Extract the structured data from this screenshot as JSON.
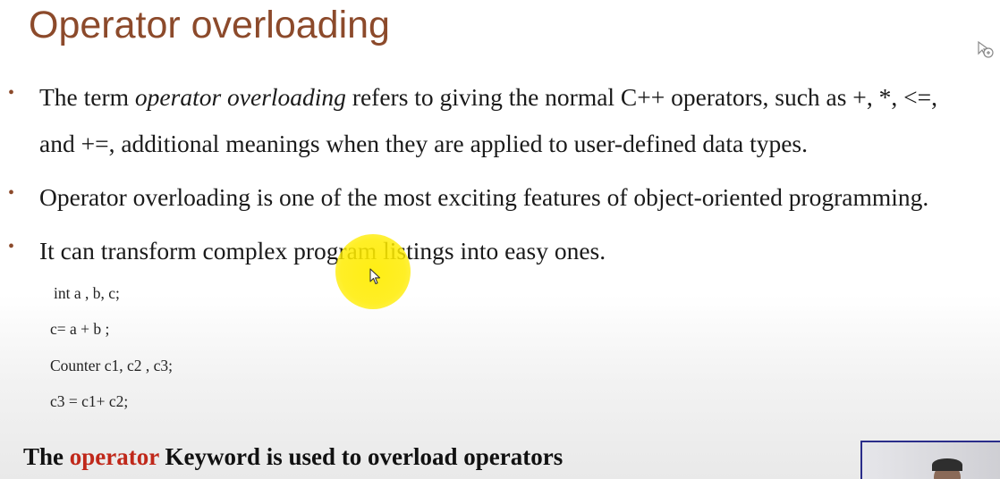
{
  "slide": {
    "title": "Operator overloading",
    "bullets": [
      {
        "line1_before": "The term ",
        "line1_em": "operator overloading",
        "line1_after": " refers to giving the normal C++ operators, such as +, *, <=,",
        "line2": "and +=, additional meanings when they are applied to user-defined data types."
      },
      {
        "text": "Operator overloading is one of the most exciting features of object-oriented programming."
      },
      {
        "text": "It can transform complex program listings into easy ones."
      }
    ],
    "bullet_marker": "•",
    "code": [
      "int a , b, c;",
      "c= a + b ;",
      "Counter c1, c2 , c3;",
      "c3 = c1+ c2;"
    ],
    "footer": {
      "before": "The ",
      "keyword": "operator",
      "after": " Keyword is used to overload operators"
    }
  },
  "colors": {
    "title": "#8c4a2b",
    "keyword": "#c0281a",
    "highlight": "#ffec00",
    "thumbnail_border": "#2a2d8a"
  },
  "icons": {
    "overlay": "cursor-highlight-icon",
    "pointer": "mouse-pointer-icon"
  }
}
